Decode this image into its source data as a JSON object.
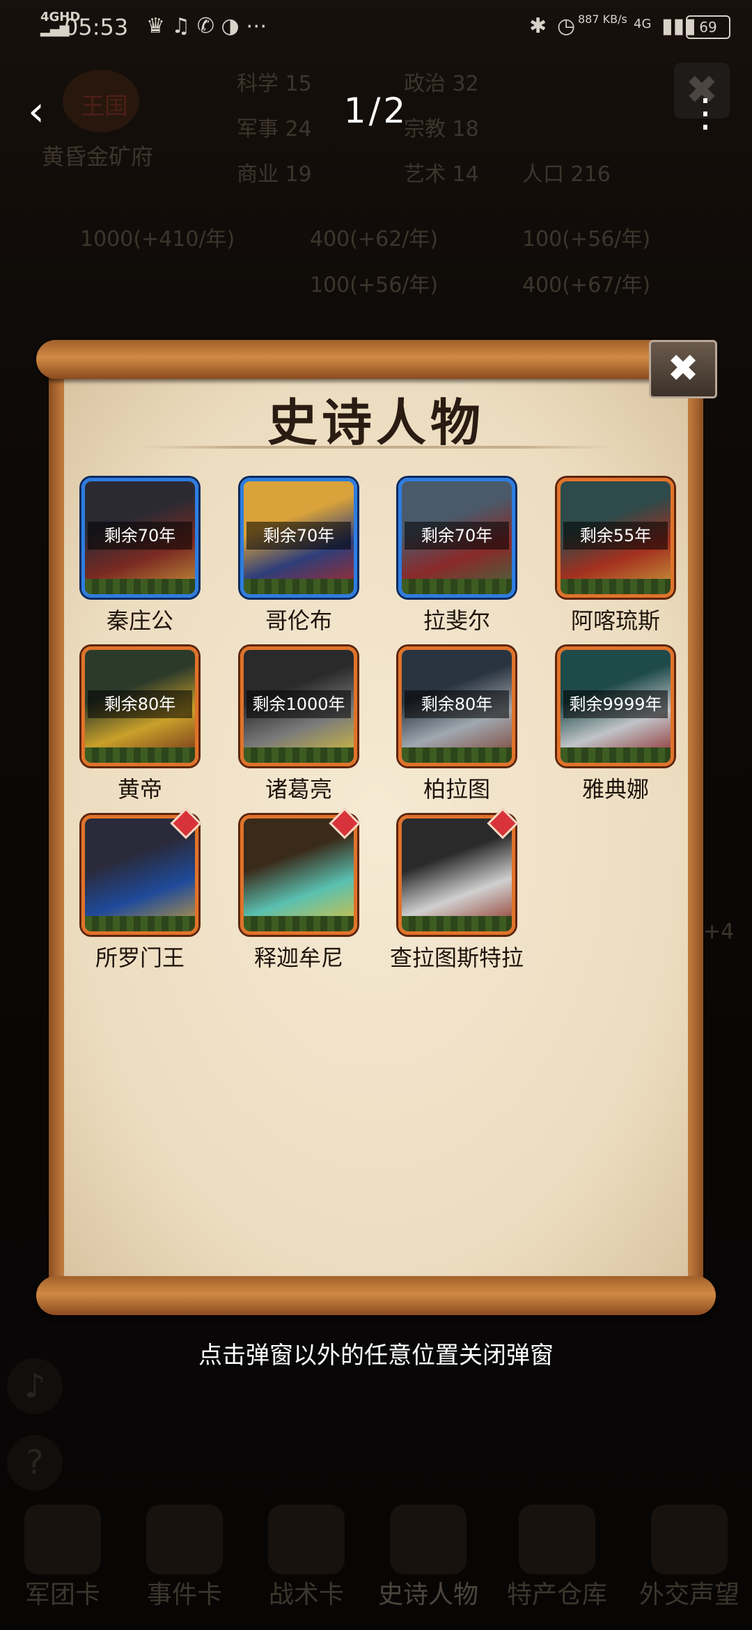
{
  "status_bar": {
    "network": "4GHD",
    "time": "05:53",
    "speed": "887 KB/s",
    "signal": "4G",
    "battery": "69"
  },
  "header": {
    "page_counter": "1/2"
  },
  "background": {
    "kingdom_title": "王国",
    "kingdom_name": "黄昏金矿府",
    "stats": [
      {
        "label": "科学",
        "value": "15"
      },
      {
        "label": "政治",
        "value": "32"
      },
      {
        "label": "军事",
        "value": "24"
      },
      {
        "label": "宗教",
        "value": "18"
      },
      {
        "label": "商业",
        "value": "19"
      },
      {
        "label": "艺术",
        "value": "14"
      },
      {
        "label": "人口",
        "value": "216"
      }
    ],
    "resources": [
      "1000(+410/年)",
      "400(+62/年)",
      "100(+56/年)",
      "100(+56/年)",
      "400(+67/年)"
    ],
    "side_number": "+4"
  },
  "dialog": {
    "title": "史诗人物",
    "characters": [
      {
        "name": "秦庄公",
        "timer": "剩余70年",
        "frame": "blue",
        "colors": [
          "#2b2a33",
          "#7a2a22",
          "#c9963c"
        ]
      },
      {
        "name": "哥伦布",
        "timer": "剩余70年",
        "frame": "blue",
        "colors": [
          "#d9a23a",
          "#2f3e7a",
          "#b02a22"
        ]
      },
      {
        "name": "拉斐尔",
        "timer": "剩余70年",
        "frame": "blue",
        "colors": [
          "#4a5a6a",
          "#8a2a2a",
          "#3f6a3f"
        ]
      },
      {
        "name": "阿喀琉斯",
        "timer": "剩余55年",
        "frame": "orange",
        "colors": [
          "#2e4a4a",
          "#a3301f",
          "#c99f3c"
        ]
      },
      {
        "name": "黄帝",
        "timer": "剩余80年",
        "frame": "orange",
        "colors": [
          "#2c3a2a",
          "#c9a02a",
          "#6a2a1a"
        ]
      },
      {
        "name": "诸葛亮",
        "timer": "剩余1000年",
        "frame": "orange",
        "colors": [
          "#2a2a2a",
          "#7a7a7a",
          "#d9c23a"
        ]
      },
      {
        "name": "柏拉图",
        "timer": "剩余80年",
        "frame": "orange",
        "colors": [
          "#2a3440",
          "#a0a8b0",
          "#7a3a2a"
        ]
      },
      {
        "name": "雅典娜",
        "timer": "剩余9999年",
        "frame": "orange",
        "colors": [
          "#1f4a4a",
          "#c0c4c8",
          "#8a1f1f"
        ]
      },
      {
        "name": "所罗门王",
        "timer": "",
        "frame": "orange",
        "is_new": true,
        "colors": [
          "#2a2a3a",
          "#1f4a9a",
          "#c99f3c"
        ]
      },
      {
        "name": "释迦牟尼",
        "timer": "",
        "frame": "orange",
        "is_new": true,
        "colors": [
          "#3a2a1a",
          "#5ac0b0",
          "#e0c03a"
        ]
      },
      {
        "name": "查拉图斯特拉",
        "timer": "",
        "frame": "orange",
        "is_new": true,
        "colors": [
          "#2a2a2a",
          "#d0d0d0",
          "#8a2a1a"
        ]
      }
    ]
  },
  "hint_text": "点击弹窗以外的任意位置关闭弹窗",
  "bottom_tabs": [
    "军团卡",
    "事件卡",
    "战术卡",
    "史诗人物",
    "特产仓库",
    "外交声望"
  ]
}
